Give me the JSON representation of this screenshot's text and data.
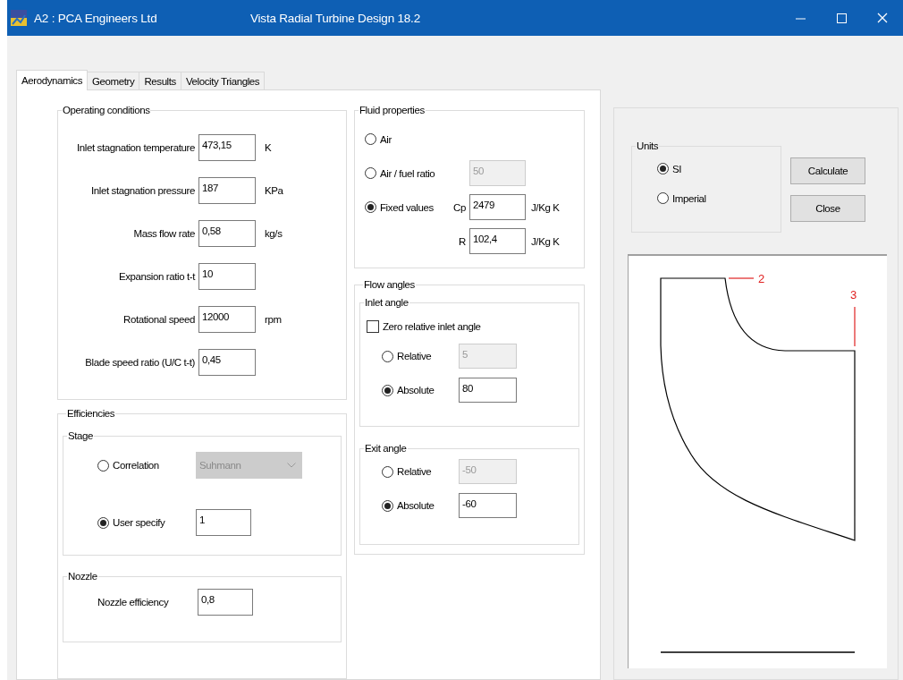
{
  "window": {
    "title": "A2 : PCA Engineers Ltd",
    "app_title": "Vista Radial Turbine Design 18.2"
  },
  "tabs": [
    {
      "label": "Aerodynamics",
      "selected": true
    },
    {
      "label": "Geometry",
      "selected": false
    },
    {
      "label": "Results",
      "selected": false
    },
    {
      "label": "Velocity Triangles",
      "selected": false
    }
  ],
  "operating_conditions": {
    "title": "Operating conditions",
    "fields": [
      {
        "label": "Inlet stagnation temperature",
        "value": "473,15",
        "unit": "K"
      },
      {
        "label": "Inlet stagnation pressure",
        "value": "187",
        "unit": "KPa"
      },
      {
        "label": "Mass flow rate",
        "value": "0,58",
        "unit": "kg/s"
      },
      {
        "label": "Expansion ratio t-t",
        "value": "10"
      },
      {
        "label": "Rotational speed",
        "value": "12000",
        "unit": "rpm"
      },
      {
        "label": "Blade speed ratio (U/C t-t)",
        "value": "0,45"
      }
    ]
  },
  "efficiencies": {
    "title": "Efficiencies",
    "stage": {
      "title": "Stage",
      "options": [
        {
          "label": "Correlation",
          "selected": false,
          "kind": "dropdown",
          "value": "Suhmann",
          "disabled": true
        },
        {
          "label": "User specify",
          "selected": true,
          "kind": "input",
          "value": "1",
          "disabled": false
        }
      ]
    },
    "nozzle": {
      "title": "Nozzle",
      "label": "Nozzle efficiency",
      "value": "0,8"
    }
  },
  "fluid_properties": {
    "title": "Fluid properties",
    "options": [
      {
        "label": "Air",
        "selected": false
      },
      {
        "label": "Air / fuel ratio",
        "selected": false,
        "value": "50",
        "disabled": true
      },
      {
        "label": "Fixed values",
        "selected": true,
        "fields": [
          {
            "symbol": "Cp",
            "value": "2479",
            "unit": "J/Kg K"
          },
          {
            "symbol": "R",
            "value": "102,4",
            "unit": "J/Kg K"
          }
        ]
      }
    ]
  },
  "flow_angles": {
    "title": "Flow angles",
    "inlet_angle": {
      "title": "Inlet angle",
      "checkbox": {
        "label": "Zero relative inlet angle",
        "checked": false
      },
      "options": [
        {
          "label": "Relative",
          "selected": false,
          "value": "5",
          "disabled": true
        },
        {
          "label": "Absolute",
          "selected": true,
          "value": "80",
          "disabled": false
        }
      ]
    },
    "exit_angle": {
      "title": "Exit angle",
      "options": [
        {
          "label": "Relative",
          "selected": false,
          "value": "-50",
          "disabled": true
        },
        {
          "label": "Absolute",
          "selected": true,
          "value": "-60",
          "disabled": false
        }
      ]
    }
  },
  "units": {
    "title": "Units",
    "options": [
      {
        "label": "SI",
        "selected": true
      },
      {
        "label": "Imperial",
        "selected": false
      }
    ]
  },
  "buttons": [
    "Calculate",
    "Close"
  ],
  "diagram": {
    "station_labels": [
      "2",
      "3"
    ]
  }
}
